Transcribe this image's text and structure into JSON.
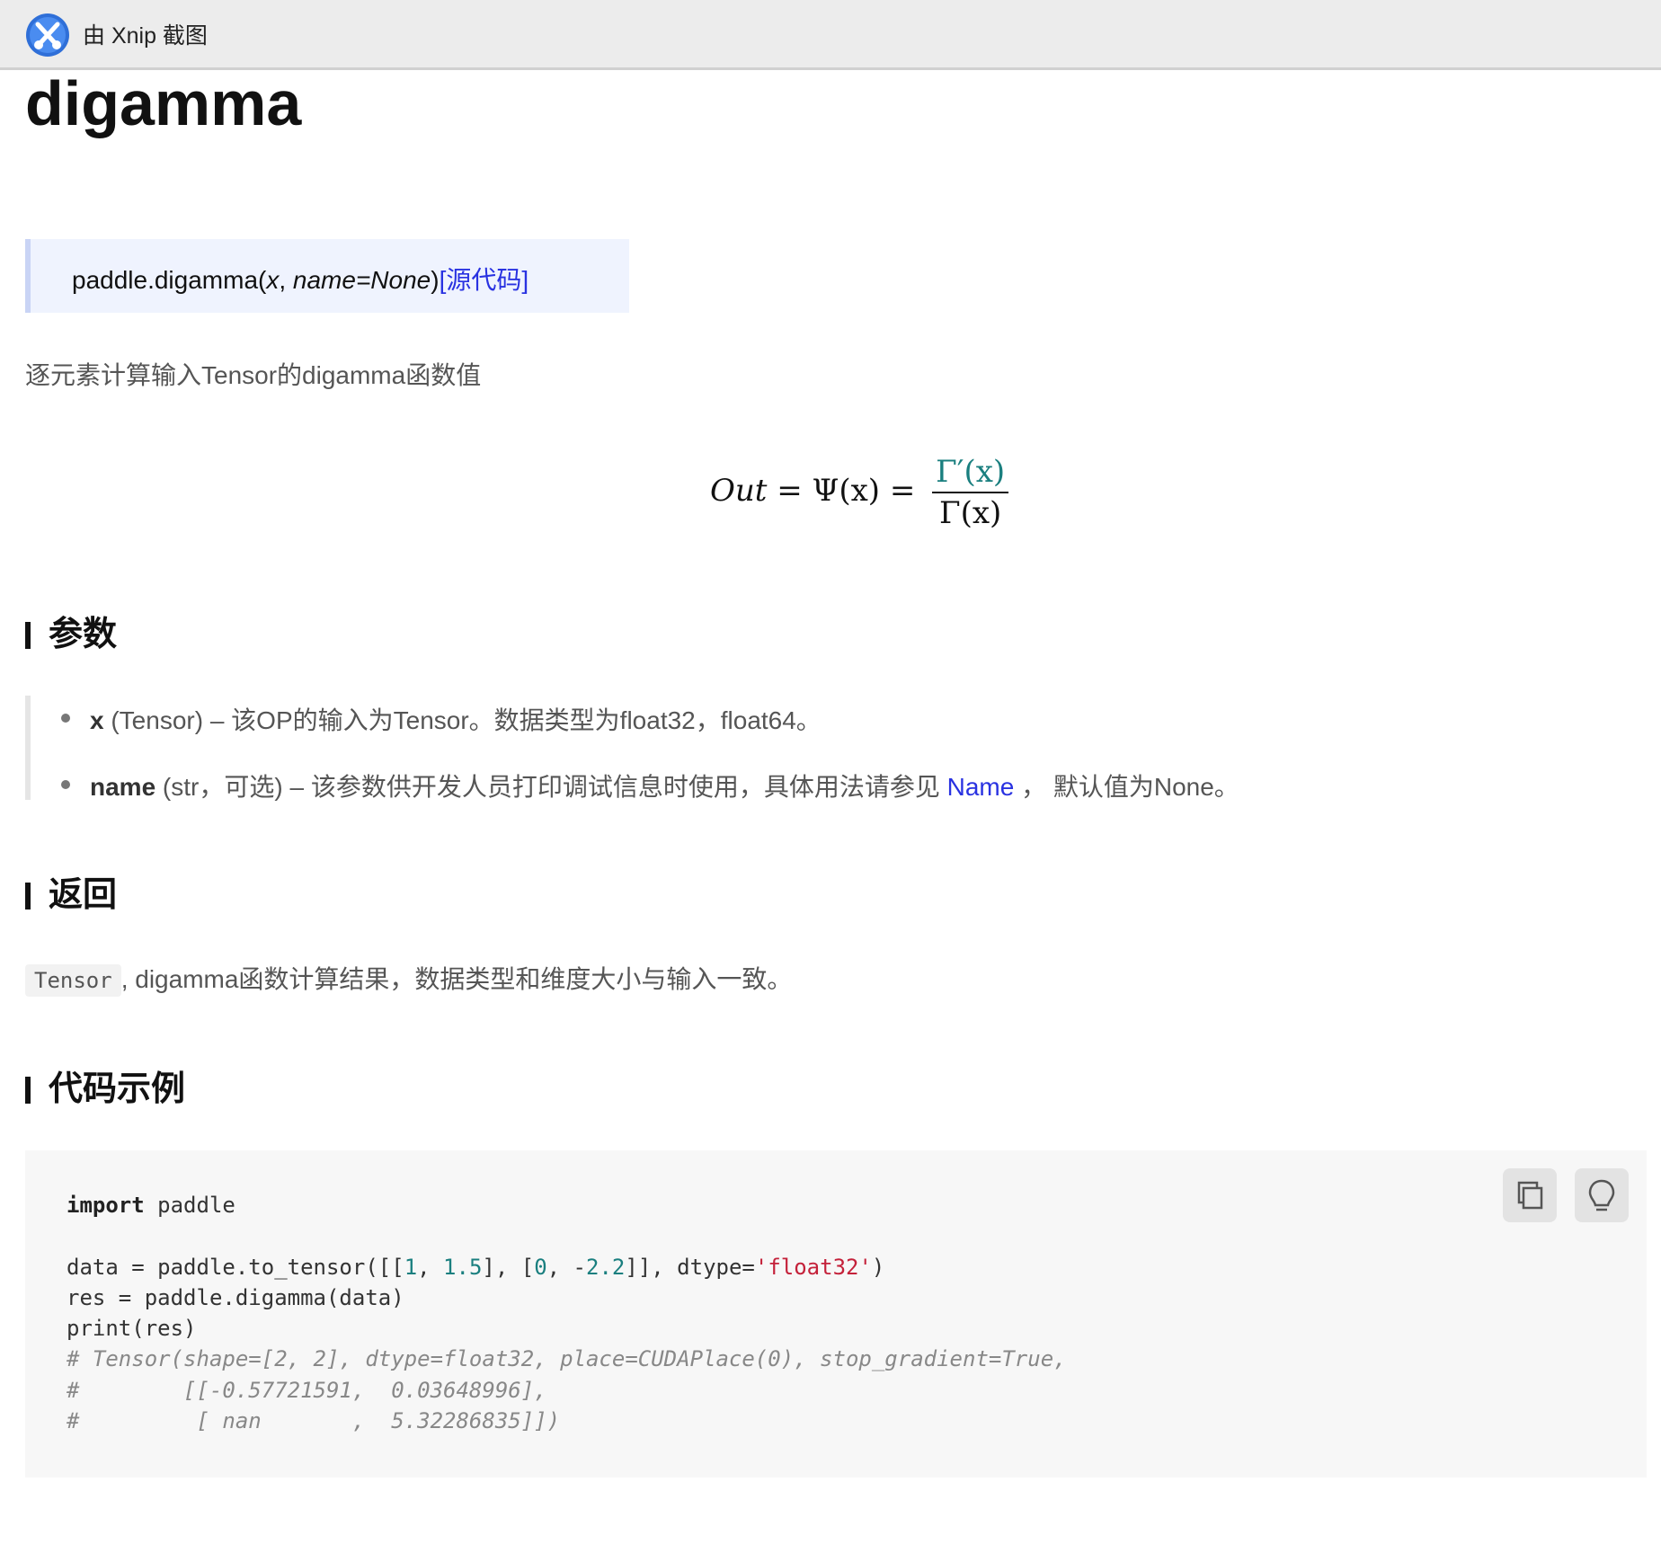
{
  "titlebar": {
    "text": "由 Xnip 截图",
    "icon": "xnip-app-icon"
  },
  "page": {
    "title": "digamma",
    "signature": {
      "prefix": "paddle.digamma(",
      "arg_x": "x",
      "sep": ", ",
      "arg_name": "name=None",
      "suffix": ")",
      "source_link": "[源代码]"
    },
    "description": "逐元素计算输入Tensor的digamma函数值",
    "formula": {
      "lhs": "Out",
      "eq1": " = Ψ(x) = ",
      "numerator": "Γ′(x)",
      "denominator": "Γ(x)"
    }
  },
  "sections": {
    "params_title": "参数",
    "returns_title": "返回",
    "example_title": "代码示例"
  },
  "params": [
    {
      "name": "x",
      "rest": " (Tensor) – 该OP的输入为Tensor。数据类型为float32，float64。"
    },
    {
      "name": "name",
      "rest_before": " (str，可选) – 该参数供开发人员打印调试信息时使用，具体用法请参见 ",
      "link": "Name",
      "rest_after": " ， 默认值为None。"
    }
  ],
  "returns": {
    "code": "Tensor",
    "text": ", digamma函数计算结果，数据类型和维度大小与输入一致。"
  },
  "code": {
    "line1_kw": "import",
    "line1_rest": " paddle",
    "line3_a": "data = paddle.to_tensor([[",
    "line3_n1": "1",
    "line3_b": ", ",
    "line3_n2": "1.5",
    "line3_c": "], [",
    "line3_n3": "0",
    "line3_d": ", -",
    "line3_n4": "2.2",
    "line3_e": "]], dtype=",
    "line3_str": "'float32'",
    "line3_f": ")",
    "line4": "res = paddle.digamma(data)",
    "line5": "print(res)",
    "comment1": "# Tensor(shape=[2, 2], dtype=float32, place=CUDAPlace(0), stop_gradient=True,",
    "comment2": "#        [[-0.57721591,  0.03648996],",
    "comment3": "#         [ nan       ,  5.32286835]])"
  },
  "code_buttons": {
    "copy_icon": "copy-icon",
    "tip_icon": "lightbulb-icon"
  }
}
